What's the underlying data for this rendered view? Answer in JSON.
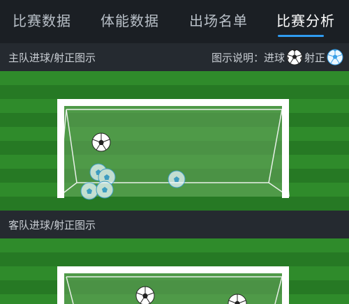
{
  "tabs": [
    {
      "label": "比赛数据",
      "active": false
    },
    {
      "label": "体能数据",
      "active": false
    },
    {
      "label": "出场名单",
      "active": false
    },
    {
      "label": "比赛分析",
      "active": true
    }
  ],
  "home_section": {
    "title": "主队进球/射正图示",
    "legend_label": "图示说明：进球",
    "legend_goal_icon": "goal-ball-icon",
    "legend_shot_label": "射正",
    "legend_shot_icon": "shot-on-target-ball-icon"
  },
  "away_section": {
    "title": "客队进球/射正图示"
  },
  "colors": {
    "tab_active": "#ffffff",
    "tab_inactive": "#b9c0c8",
    "tab_indicator": "#2f9bf0",
    "section_header_bg": "#252a30",
    "pitch_green": "#2f8b2b",
    "goal_ball": "#2a2a2a",
    "shot_ball": "#3aa0e8"
  }
}
